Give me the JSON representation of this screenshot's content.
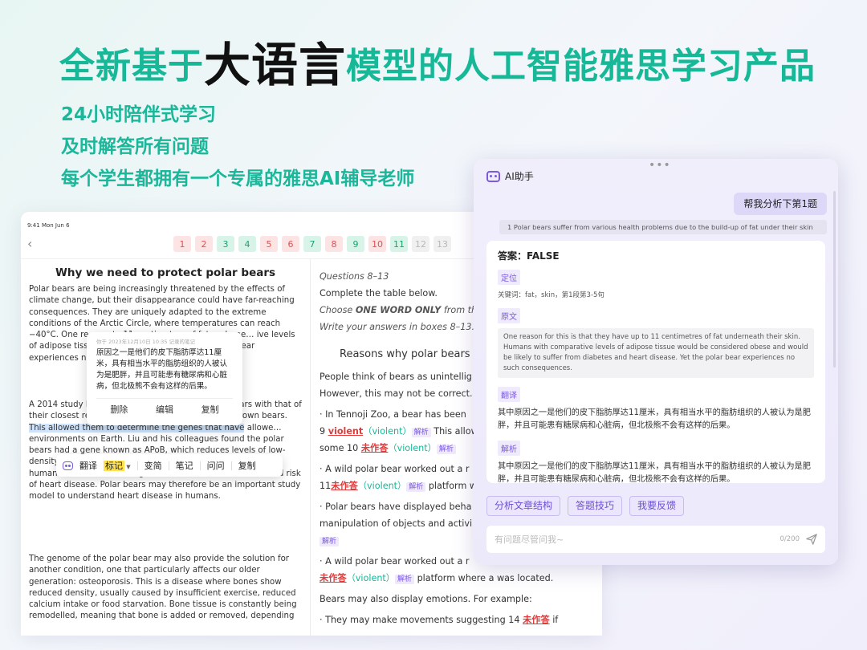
{
  "headline": {
    "before": "全新基于",
    "highlight": "大语言",
    "after": "模型的人工智能雅思学习产品"
  },
  "features": [
    "24小时陪伴式学习",
    "及时解答所有问题",
    "每个学生都拥有一个专属的雅思AI辅导老师"
  ],
  "tablet": {
    "status_time": "9:41  Mon Jun 6",
    "question_numbers": [
      {
        "n": "1",
        "state": "red"
      },
      {
        "n": "2",
        "state": "red"
      },
      {
        "n": "3",
        "state": "green"
      },
      {
        "n": "4",
        "state": "green"
      },
      {
        "n": "5",
        "state": "red"
      },
      {
        "n": "6",
        "state": "red"
      },
      {
        "n": "7",
        "state": "green"
      },
      {
        "n": "8",
        "state": "red"
      },
      {
        "n": "9",
        "state": "green"
      },
      {
        "n": "10",
        "state": "red"
      },
      {
        "n": "11",
        "state": "green"
      },
      {
        "n": "12",
        "state": "grey"
      },
      {
        "n": "13",
        "state": "grey"
      }
    ],
    "article": {
      "title": "Why we need to protect polar bears",
      "p1": "Polar bears are being increasingly threatened by the effects of climate change, but their disappearance could have far-reaching consequences. They are uniquely adapted to the extreme conditions of the Arctic Circle, where temperatures can reach −40°C. One re… up to 11 centimetres of fat underne… ive levels of adipose tissue… d be likely to suffer from di… r bear experiences n…",
      "p2a": "A 2014 study l… ight on this mystery. They… lar bears with that of their closest relatives from a warmer climate, the brown bears. ",
      "p2_hl": "This allowed them to determine the genes that have",
      "p2b": " allowe… environments on Earth. Liu and his colleagues found the polar bears had a gene known as APoB, which reduces levels of low-density lipoproteins (LDLs) — a form of ‘bad’ cholesterol. In humans, mutations of this gene are associated with increased risk of heart disease. Polar bears may therefore be an important study model to understand heart disease in humans.",
      "p3": "The genome of the polar bear may also provide the solution for another condition, one that particularly affects our older generation: osteoporosis. This is a disease where bones show reduced density, usually caused by insufficient exercise, reduced calcium intake or food starvation. Bone tissue is constantly being remodelled, meaning that bone is added or removed, depending"
    },
    "note": {
      "meta": "你于 2023年12月10日 10:35 记录的笔记",
      "text": "原因之一是他们的皮下脂肪厚达11厘米，具有相当水平的脂肪组织的人被认为是肥胖，并且可能患有糖尿病和心脏病，但北极熊不会有这样的后果。",
      "actions": [
        "删除",
        "编辑",
        "复制"
      ]
    },
    "toolbar": {
      "translate": "翻译",
      "mark": "标记",
      "simplify": "变简",
      "notes": "笔记",
      "ask": "问问",
      "copy": "复制"
    },
    "questions": {
      "heading": "Questions 8–13",
      "instr1": "Complete the table below.",
      "instr2_pre": "Choose ",
      "instr2_bold": "ONE WORD ONLY",
      "instr2_post": " from the",
      "instr3": "Write your answers in boxes 8–13.",
      "reasons": "Reasons why polar bears s",
      "line1": "People think of bears as unintellig",
      "line2": "However, this may not be correct.",
      "b1": "· In Tennoji Zoo, a bear has been",
      "b1_n": "9 ",
      "b1_ans": "violent",
      "b1_alt": "（violent）",
      "b1_tag": "解析",
      "b1_tail": " This allow",
      "b1_n2": "some 10 ",
      "b1_ans2": "未作答",
      "b1_alt2": "（violent）",
      "b1_tag2": "解析",
      "b2": "· A wild polar bear worked out a r",
      "b2_n": "11",
      "b2_ans": "未作答",
      "b2_alt": "（violent）",
      "b2_tag": "解析",
      "b2_tail": " platform w",
      "b3": "· Polar bears have displayed beha",
      "b3b": "manipulation of objects and activi",
      "b3_tag": "解析",
      "b4": "· A wild polar bear worked out a r",
      "b4_ans": "未作答",
      "b4_alt": "（violent）",
      "b4_tag": "解析",
      "b4_tail": " platform where a was located.",
      "b5": "Bears may also display emotions. For example:",
      "b6": "· They may make movements suggesting 14 ",
      "b6_ans": "未作答",
      "b6_tail": " if"
    }
  },
  "ai": {
    "title": "AI助手",
    "user_msg": "帮我分析下第1题",
    "quote": "1 Polar bears suffer from various health problems due to the build-up of fat under their skin",
    "answer": "答案：FALSE",
    "sec_locate": "定位",
    "keywords": "关键词：fat，skin，第1段第3-5句",
    "sec_original": "原文",
    "original": "One reason for this is that they have up to 11 centimetres of fat underneath their skin. Humans with comparative levels of adipose tissue would be considered obese and would be likely to suffer from diabetes and heart disease. Yet the polar bear experiences no such consequences.",
    "sec_translate": "翻译",
    "translation": "其中原因之一是他们的皮下脂肪厚达11厘米，具有相当水平的脂肪组织的人被认为是肥胖，并且可能患有糖尿病和心脏病，但北极熊不会有这样的后果。",
    "sec_analysis": "解析",
    "analysis": "其中原因之一是他们的皮下脂肪厚达11厘米，具有相当水平的脂肪组织的人被认为是肥胖，并且可能患有糖尿病和心脏病，但北极熊不会有这样的后果。",
    "chips": [
      "分析文章结构",
      "答题技巧",
      "我要反馈"
    ],
    "input_placeholder": "有问题尽管问我~",
    "input_count": "0/200"
  }
}
